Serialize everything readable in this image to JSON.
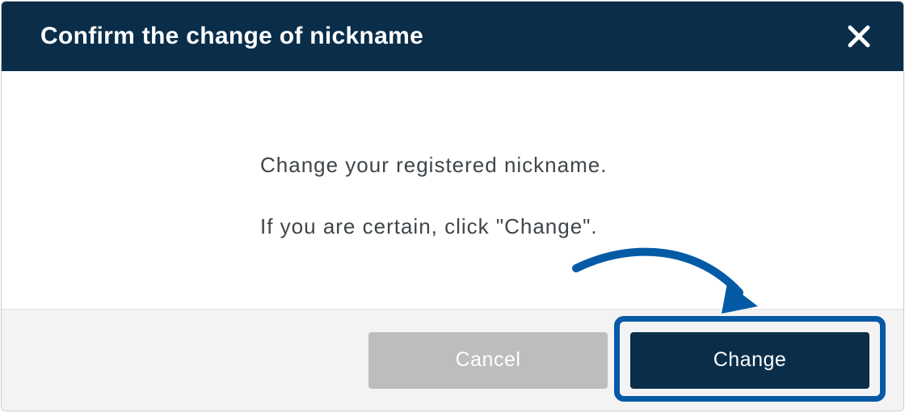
{
  "dialog": {
    "title": "Confirm the change of nickname",
    "body_line1": "Change your registered nickname.",
    "body_line2": "If you are certain, click \"Change\"."
  },
  "buttons": {
    "cancel": "Cancel",
    "change": "Change"
  },
  "colors": {
    "header_bg": "#0a2e4a",
    "accent": "#055aa6",
    "cancel_bg": "#bdbdbd"
  }
}
